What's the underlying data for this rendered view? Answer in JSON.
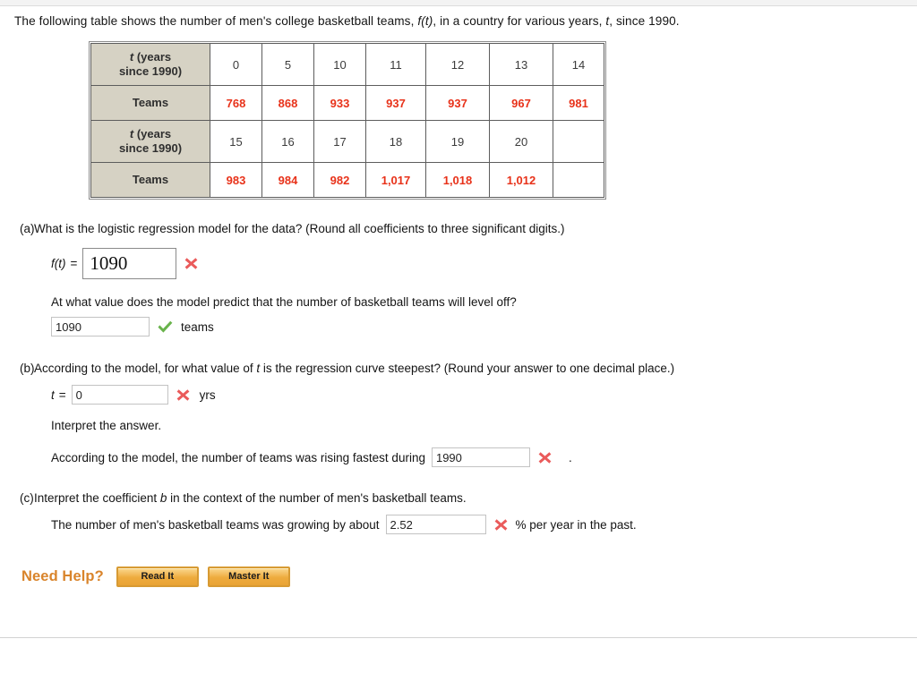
{
  "intro": {
    "before_ft": "The following table shows the number of men's college basketball teams, ",
    "ft": "f(t)",
    "middle": ", in a country for various years, ",
    "t": "t",
    "after": ", since 1990."
  },
  "table": {
    "row_head_t": "t (years since 1990)",
    "row_head_t_line1": "t",
    "row_head_t_line1_rest": " (years",
    "row_head_t_line2": "since 1990)",
    "row_head_teams": "Teams",
    "block1": {
      "t": [
        "0",
        "5",
        "10",
        "11",
        "12",
        "13",
        "14"
      ],
      "teams": [
        "768",
        "868",
        "933",
        "937",
        "937",
        "967",
        "981"
      ]
    },
    "block2": {
      "t": [
        "15",
        "16",
        "17",
        "18",
        "19",
        "20",
        ""
      ],
      "teams": [
        "983",
        "984",
        "982",
        "1,017",
        "1,018",
        "1,012",
        ""
      ]
    },
    "header_bg": "#d6d2c4",
    "value_color": "#e8321a"
  },
  "parts": {
    "a": {
      "label": "(a)",
      "question": "What is the logistic regression model for the data? (Round all coefficients to three significant digits.)",
      "ft_label": "f(t)",
      "equals": "=",
      "ft_value": "1090",
      "ft_status": "incorrect",
      "followup_question": "At what value does the model predict that the number of basketball teams will level off?",
      "level_value": "1090",
      "level_status": "correct",
      "level_unit": "teams"
    },
    "b": {
      "label": "(b)",
      "question": "According to the model, for what value of t is the regression curve steepest? (Round your answer to one decimal place.)",
      "question_pre": "According to the model, for what value of ",
      "question_var": "t",
      "question_post": " is the regression curve steepest? (Round your answer to one decimal place.)",
      "t_label": "t",
      "equals": "=",
      "t_value": "0",
      "t_status": "incorrect",
      "t_unit": "yrs",
      "interpret_prompt": "Interpret the answer.",
      "interpret_pre": "According to the model, the number of teams was rising fastest during",
      "year_value": "1990",
      "year_status": "incorrect",
      "interpret_post": "."
    },
    "c": {
      "label": "(c)",
      "question_pre": "Interpret the coefficient ",
      "question_var": "b",
      "question_post": " in the context of the number of men's basketball teams.",
      "sentence_pre": "The number of men's basketball teams was growing by about",
      "pct_value": "2.52",
      "pct_status": "incorrect",
      "sentence_post": "% per year in the past."
    }
  },
  "need_help": {
    "label": "Need Help?",
    "read_it": "Read It",
    "master_it": "Master It",
    "accent_color": "#d9842b"
  },
  "icons": {
    "incorrect_color": "#ea5b5b",
    "correct_color": "#69b34c"
  }
}
